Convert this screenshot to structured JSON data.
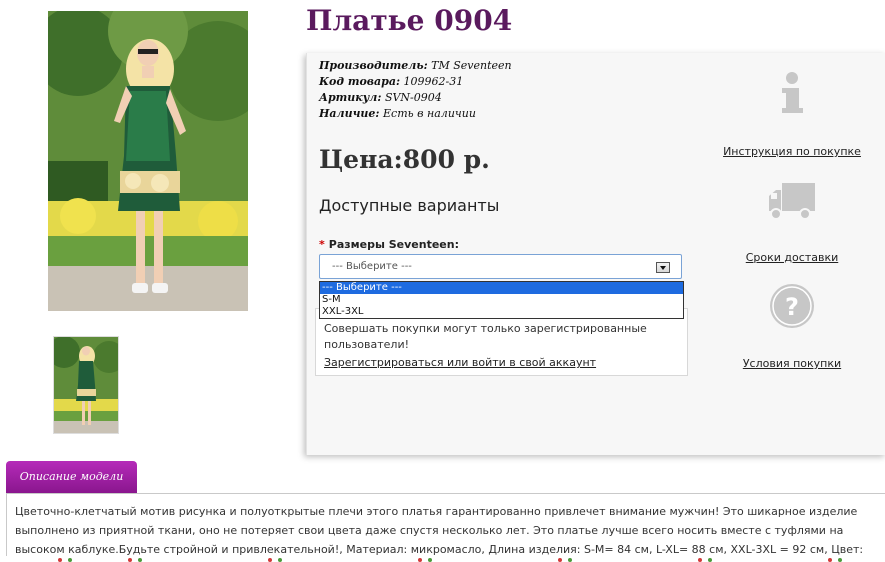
{
  "product": {
    "title": "Платье 0904",
    "manufacturer_label": "Производитель:",
    "manufacturer_value": "TM Seventeen",
    "code_label": "Код товара:",
    "code_value": "109962-31",
    "article_label": "Артикул:",
    "article_value": "SVN-0904",
    "availability_label": "Наличие:",
    "availability_value": "Есть в наличии",
    "price": "Цена:800 р."
  },
  "options": {
    "heading": "Доступные варианты",
    "size_label": "Размеры Seventeen:",
    "required_mark": "*",
    "selected": "--- Выберите ---",
    "choices": [
      "--- Выберите ---",
      "S-M",
      "XXL-3XL"
    ]
  },
  "notice": {
    "text": "Совершать покупки могут только зарегистрированные пользователи!",
    "link": "Зарегистрироваться или войти в свой аккаунт"
  },
  "sidebar": {
    "items": [
      {
        "label": "Инструкция по покупке",
        "icon": "info-icon"
      },
      {
        "label": "Сроки доставки",
        "icon": "truck-icon"
      },
      {
        "label": "Условия покупки",
        "icon": "question-icon"
      }
    ]
  },
  "description": {
    "tab_label": "Описание модели",
    "text": "Цветочно-клетчатый мотив рисунка и полуоткрытые плечи этого платья гарантированно привлечет внимание мужчин! Это шикарное изделие выполнено из приятной ткани, оно не потеряет свои цвета даже спустя несколько лет. Это платье лучше всего носить вместе с туфлями на высоком каблуке.Будьте стройной и привлекательной!, Материал: микромасло, Длина изделия: S-M= 84 см, L-XL= 88 см, XXL-3XL = 92 см, Цвет: зеленый принт"
  },
  "colors": {
    "title": "#5a1a5e",
    "tab": "#9c1fa0",
    "selected_option": "#1e6be0",
    "icon_gray": "#c7c7c7"
  }
}
